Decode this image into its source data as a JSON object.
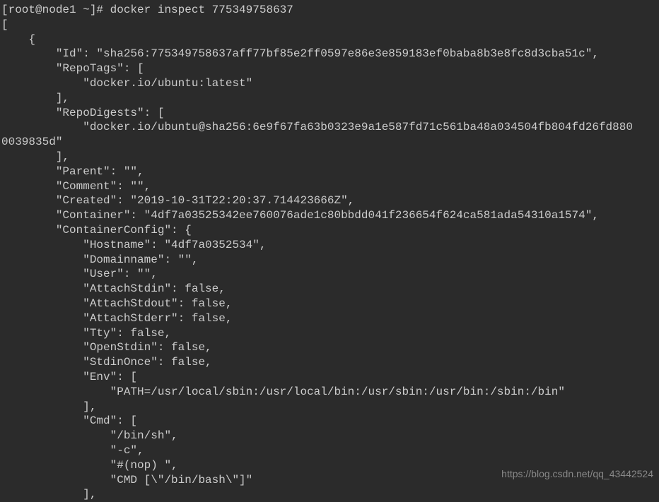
{
  "prompt": "[root@node1 ~]# docker inspect 775349758637",
  "lines": [
    "[",
    "    {",
    "        \"Id\": \"sha256:775349758637aff77bf85e2ff0597e86e3e859183ef0baba8b3e8fc8d3cba51c\",",
    "        \"RepoTags\": [",
    "            \"docker.io/ubuntu:latest\"",
    "        ],",
    "        \"RepoDigests\": [",
    "            \"docker.io/ubuntu@sha256:6e9f67fa63b0323e9a1e587fd71c561ba48a034504fb804fd26fd880",
    "0039835d\"",
    "        ],",
    "        \"Parent\": \"\",",
    "        \"Comment\": \"\",",
    "        \"Created\": \"2019-10-31T22:20:37.714423666Z\",",
    "        \"Container\": \"4df7a03525342ee760076ade1c80bbdd041f236654f624ca581ada54310a1574\",",
    "        \"ContainerConfig\": {",
    "            \"Hostname\": \"4df7a0352534\",",
    "            \"Domainname\": \"\",",
    "            \"User\": \"\",",
    "            \"AttachStdin\": false,",
    "            \"AttachStdout\": false,",
    "            \"AttachStderr\": false,",
    "            \"Tty\": false,",
    "            \"OpenStdin\": false,",
    "            \"StdinOnce\": false,",
    "            \"Env\": [",
    "                \"PATH=/usr/local/sbin:/usr/local/bin:/usr/sbin:/usr/bin:/sbin:/bin\"",
    "            ],",
    "            \"Cmd\": [",
    "                \"/bin/sh\",",
    "                \"-c\",",
    "                \"#(nop) \",",
    "                \"CMD [\\\"/bin/bash\\\"]\"",
    "            ],"
  ],
  "watermark": "https://blog.csdn.net/qq_43442524"
}
